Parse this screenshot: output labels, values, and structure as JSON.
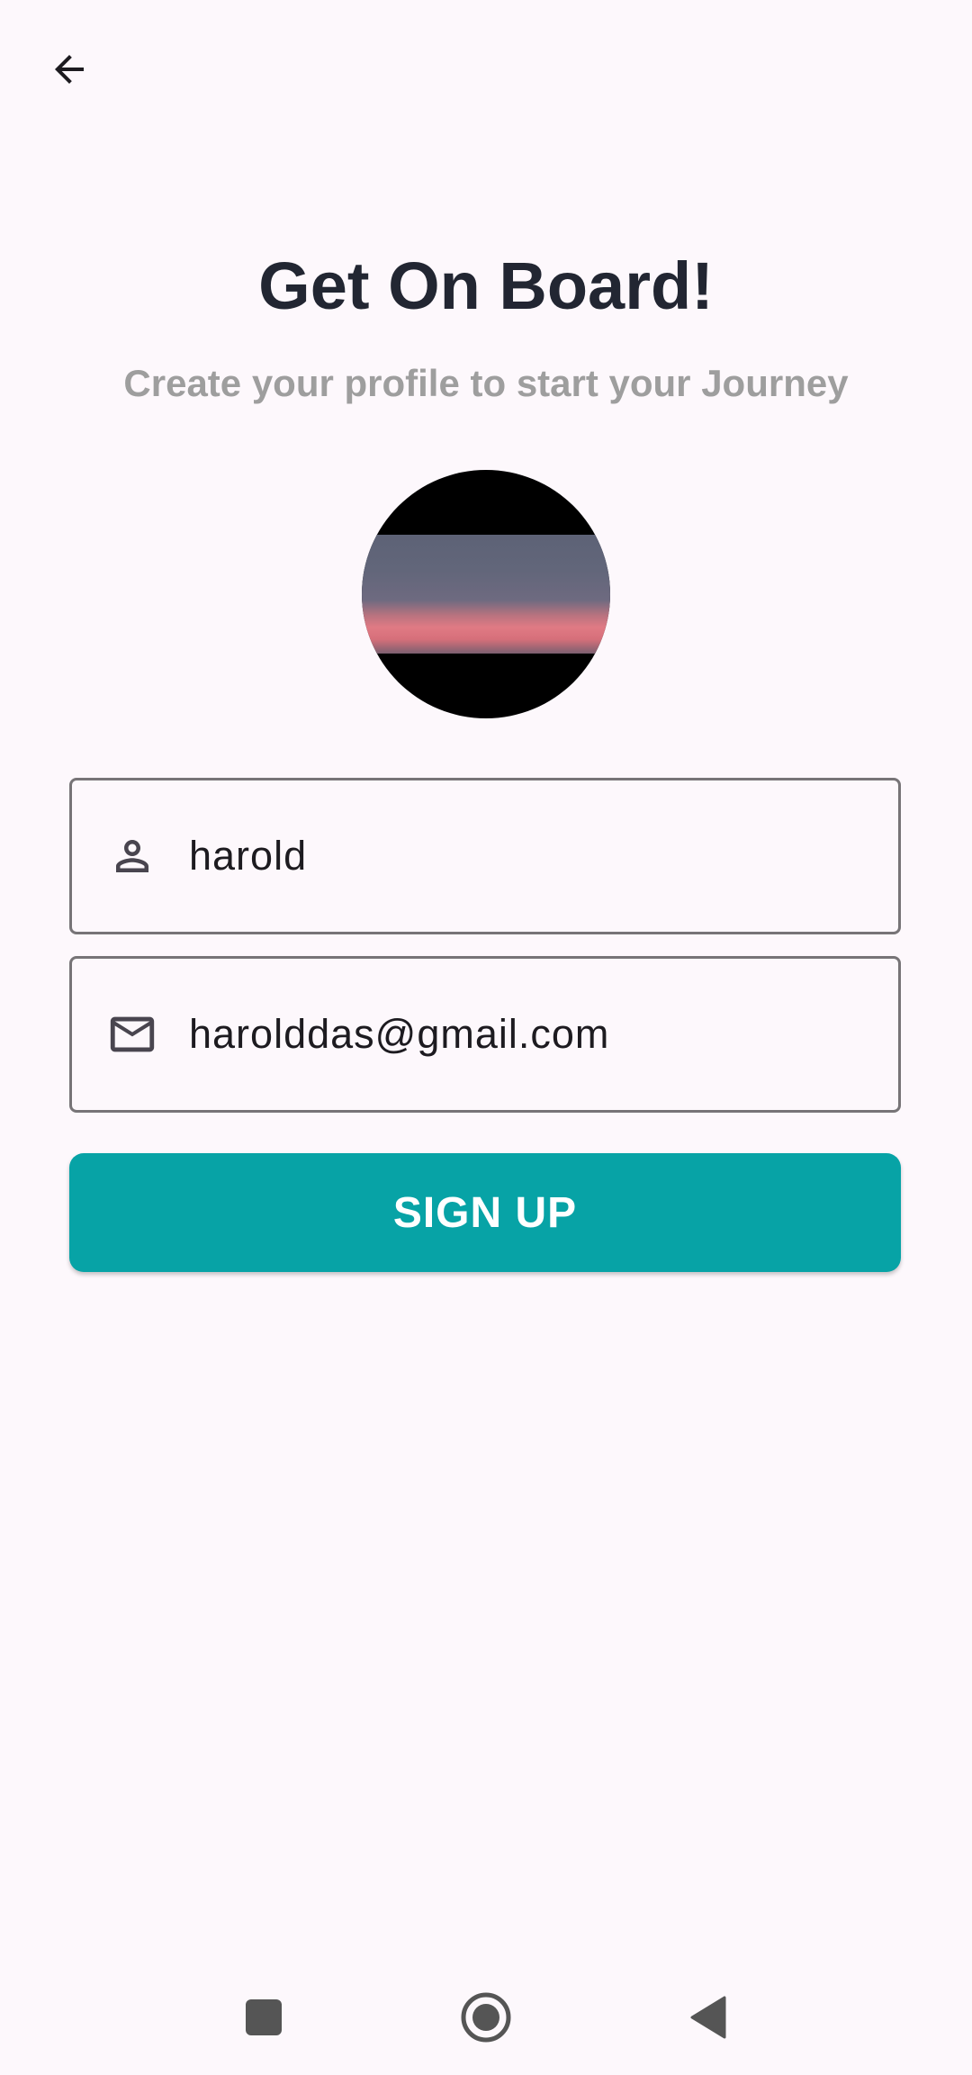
{
  "header": {
    "back_icon": "arrow-back-icon"
  },
  "main": {
    "title": "Get On Board!",
    "subtitle": "Create your profile to start your Journey",
    "avatar": "profile-photo"
  },
  "form": {
    "name_field": {
      "icon": "person-icon",
      "value": "harold"
    },
    "email_field": {
      "icon": "mail-icon",
      "value": "harolddas@gmail.com"
    },
    "signup_label": "SIGN UP"
  },
  "colors": {
    "background": "#fdf8fc",
    "title": "#222632",
    "subtitle": "#9e9e9e",
    "accent": "#07a3a6",
    "field_border": "#777477"
  },
  "nav_bar": {
    "recents_icon": "square-icon",
    "home_icon": "circle-icon",
    "back_icon": "triangle-back-icon"
  }
}
